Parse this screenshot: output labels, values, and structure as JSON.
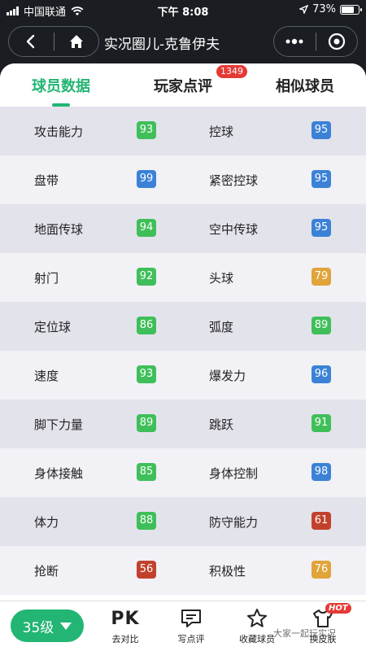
{
  "status_bar": {
    "carrier": "中国联通",
    "time": "下午 8:08",
    "battery": "73%"
  },
  "nav": {
    "title": "实况圈儿-克鲁伊夫",
    "back_icon": "chevron-left-icon",
    "home_icon": "home-icon",
    "more_icon": "more-dots-icon",
    "record_icon": "target-icon"
  },
  "tabs": [
    {
      "label": "球员数据",
      "active": true
    },
    {
      "label": "玩家点评",
      "badge": "1349"
    },
    {
      "label": "相似球员"
    }
  ],
  "colors": {
    "accent": "#22b573",
    "green": "#3fbf59",
    "blue": "#3b82d6",
    "orange": "#e0a43a",
    "red": "#c2412c"
  },
  "stats": [
    {
      "left": {
        "label": "攻击能力",
        "value": "93",
        "color": "#3fbf59"
      },
      "right": {
        "label": "控球",
        "value": "95",
        "color": "#3b82d6"
      }
    },
    {
      "left": {
        "label": "盘带",
        "value": "99",
        "color": "#3b82d6"
      },
      "right": {
        "label": "紧密控球",
        "value": "95",
        "color": "#3b82d6"
      }
    },
    {
      "left": {
        "label": "地面传球",
        "value": "94",
        "color": "#3fbf59"
      },
      "right": {
        "label": "空中传球",
        "value": "95",
        "color": "#3b82d6"
      }
    },
    {
      "left": {
        "label": "射门",
        "value": "92",
        "color": "#3fbf59"
      },
      "right": {
        "label": "头球",
        "value": "79",
        "color": "#e0a43a"
      }
    },
    {
      "left": {
        "label": "定位球",
        "value": "86",
        "color": "#3fbf59"
      },
      "right": {
        "label": "弧度",
        "value": "89",
        "color": "#3fbf59"
      }
    },
    {
      "left": {
        "label": "速度",
        "value": "93",
        "color": "#3fbf59"
      },
      "right": {
        "label": "爆发力",
        "value": "96",
        "color": "#3b82d6"
      }
    },
    {
      "left": {
        "label": "脚下力量",
        "value": "89",
        "color": "#3fbf59"
      },
      "right": {
        "label": "跳跃",
        "value": "91",
        "color": "#3fbf59"
      }
    },
    {
      "left": {
        "label": "身体接触",
        "value": "85",
        "color": "#3fbf59"
      },
      "right": {
        "label": "身体控制",
        "value": "98",
        "color": "#3b82d6"
      }
    },
    {
      "left": {
        "label": "体力",
        "value": "88",
        "color": "#3fbf59"
      },
      "right": {
        "label": "防守能力",
        "value": "61",
        "color": "#c2412c"
      }
    },
    {
      "left": {
        "label": "抢断",
        "value": "56",
        "color": "#c2412c"
      },
      "right": {
        "label": "积极性",
        "value": "76",
        "color": "#e0a43a"
      }
    }
  ],
  "bottom_bar": {
    "level_label": "35级",
    "pk_text": "PK",
    "compare_label": "去对比",
    "review_label": "写点评",
    "favorite_label": "收藏球员",
    "skin_label": "换皮肤",
    "hot_badge": "HOT",
    "watermark": "大家一起玩实况"
  }
}
